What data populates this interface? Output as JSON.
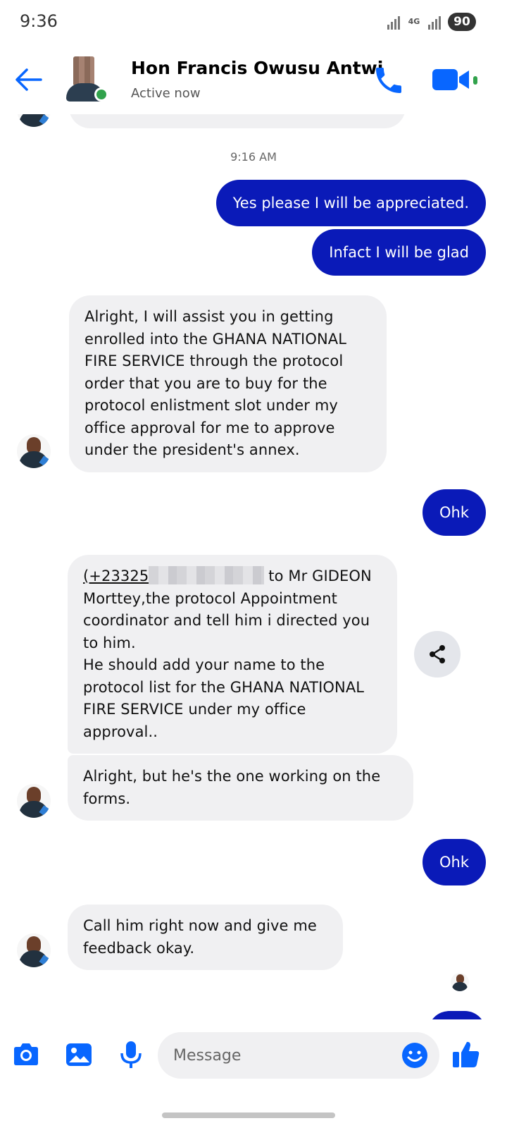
{
  "status_bar": {
    "time": "9:36",
    "network_label": "4G",
    "battery": "90"
  },
  "header": {
    "contact_name": "Hon Francis Owusu Antwi",
    "status": "Active now",
    "accent_color": "#0866ff"
  },
  "messages": {
    "timestamp": "9:16 AM",
    "out_1": "Yes please I will be appreciated.",
    "out_2": "Infact I will be glad",
    "in_1": "Alright, I will assist you in getting enrolled into the GHANA NATIONAL FIRE SERVICE through the protocol order that you are to buy for the protocol enlistment slot under my office approval for me to approve under the president's annex.",
    "out_3": "Ohk",
    "in_2_phone": "(+23325",
    "in_2_rest_first": "to Mr",
    "in_2_rest": "GIDEON Morttey,the protocol Appointment coordinator and tell him i directed you to him.",
    "in_2_line2": "He should add your name to the protocol list for the GHANA NATIONAL FIRE SERVICE under my office approval..",
    "in_3": "Alright, but he's the one working on the forms.",
    "out_4": "Ohk",
    "in_4": "Call him right now and give me feedback okay."
  },
  "composer": {
    "placeholder": "Message"
  },
  "colors": {
    "outgoing_bubble": "#0a1ab8",
    "incoming_bubble": "#f0f0f2",
    "online": "#31a24c"
  }
}
